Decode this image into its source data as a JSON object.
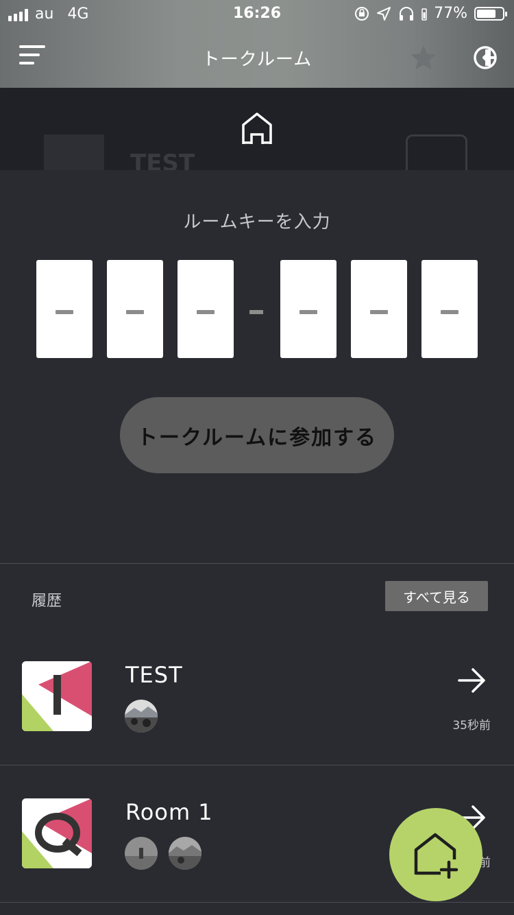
{
  "status": {
    "carrier": "au",
    "network": "4G",
    "time": "16:26",
    "battery": "77%",
    "battery_level": 0.77
  },
  "nav": {
    "title": "トークルーム"
  },
  "room_key": {
    "label": "ルームキーを入力",
    "boxes": [
      "",
      "",
      "",
      "",
      "",
      ""
    ],
    "join_label": "トークルームに参加する"
  },
  "history": {
    "label": "履歴",
    "see_all_label": "すべて見る",
    "rooms": [
      {
        "name": "TEST",
        "time": "35秒前",
        "avatar_count": 1
      },
      {
        "name": "Room 1",
        "time": "前",
        "avatar_count": 2
      }
    ]
  },
  "background_hint": {
    "name": "TEST"
  },
  "colors": {
    "accent": "#b6d36a",
    "pink": "#d94f72",
    "green": "#b2d363",
    "background": "#2a2b31"
  }
}
